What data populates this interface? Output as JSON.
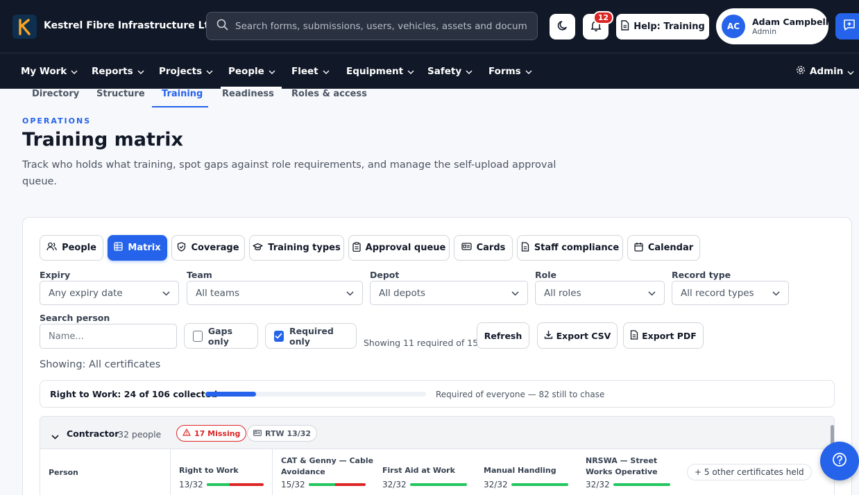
{
  "header": {
    "company": "Kestrel Fibre Infrastructure Ltd",
    "search_placeholder": "Search forms, submissions, users, vehicles, assets and document",
    "notifications_count": "12",
    "help_label": "Help: Training",
    "user": {
      "initials": "AC",
      "name": "Adam Campbell",
      "role": "Admin"
    }
  },
  "nav": {
    "items": [
      {
        "label": "My Work"
      },
      {
        "label": "Reports"
      },
      {
        "label": "Projects"
      },
      {
        "label": "People"
      },
      {
        "label": "Fleet"
      },
      {
        "label": "Equipment"
      },
      {
        "label": "Safety"
      },
      {
        "label": "Forms"
      }
    ],
    "admin_label": "Admin",
    "active": "People"
  },
  "subtabs": {
    "items": [
      {
        "label": "Directory"
      },
      {
        "label": "Structure"
      },
      {
        "label": "Training"
      },
      {
        "label": "Readiness"
      },
      {
        "label": "Roles & access"
      }
    ],
    "active": "Training"
  },
  "page": {
    "eyebrow": "OPERATIONS",
    "title": "Training matrix",
    "description": "Track who holds what training, spot gaps against role requirements, and manage the self-upload approval queue."
  },
  "view_tabs": [
    {
      "label": "People",
      "icon": "users-icon"
    },
    {
      "label": "Matrix",
      "icon": "grid-icon"
    },
    {
      "label": "Coverage",
      "icon": "shield-check-icon"
    },
    {
      "label": "Training types",
      "icon": "graduation-cap-icon"
    },
    {
      "label": "Approval queue",
      "icon": "clipboard-icon"
    },
    {
      "label": "Cards",
      "icon": "id-card-icon"
    },
    {
      "label": "Staff compliance",
      "icon": "document-icon"
    },
    {
      "label": "Calendar",
      "icon": "calendar-icon"
    }
  ],
  "active_view": "Matrix",
  "filters": {
    "expiry": {
      "label": "Expiry",
      "value": "Any expiry date"
    },
    "team": {
      "label": "Team",
      "value": "All teams"
    },
    "depot": {
      "label": "Depot",
      "value": "All depots"
    },
    "role": {
      "label": "Role",
      "value": "All roles"
    },
    "record_type": {
      "label": "Record type",
      "value": "All record types"
    },
    "search_person": {
      "label": "Search person",
      "placeholder": "Name..."
    },
    "gaps_only": {
      "label": "Gaps only",
      "checked": false
    },
    "required_only": {
      "label": "Required only",
      "checked": true
    },
    "showing_count": "Showing 11 required of 15",
    "refresh_label": "Refresh",
    "export_csv_label": "Export CSV",
    "export_pdf_label": "Export PDF"
  },
  "showing_text": "Showing: All certificates",
  "rtw_summary": {
    "label": "Right to Work: 24 of 106 collected",
    "progress": 0.23,
    "note": "Required of everyone — 82 still to chase"
  },
  "group": {
    "title": "Contractor",
    "count": "32 people",
    "missing": "17 Missing",
    "rtw": "RTW 13/32",
    "person_header": "Person",
    "certs": [
      {
        "name": "Right to Work",
        "count": "13/32",
        "held": 13,
        "total": 32
      },
      {
        "name": "CAT & Genny — Cable Avoidance",
        "count": "15/32",
        "held": 15,
        "total": 32
      },
      {
        "name": "First Aid at Work",
        "count": "32/32",
        "held": 32,
        "total": 32
      },
      {
        "name": "Manual Handling",
        "count": "32/32",
        "held": 32,
        "total": 32
      },
      {
        "name": "NRSWA — Street Works Operative",
        "count": "32/32",
        "held": 32,
        "total": 32
      }
    ],
    "other_certs": "+ 5 other certificates held"
  },
  "colors": {
    "brand": "#111827",
    "accent": "#2563eb",
    "danger": "#dc2626",
    "success": "#22c55e"
  }
}
